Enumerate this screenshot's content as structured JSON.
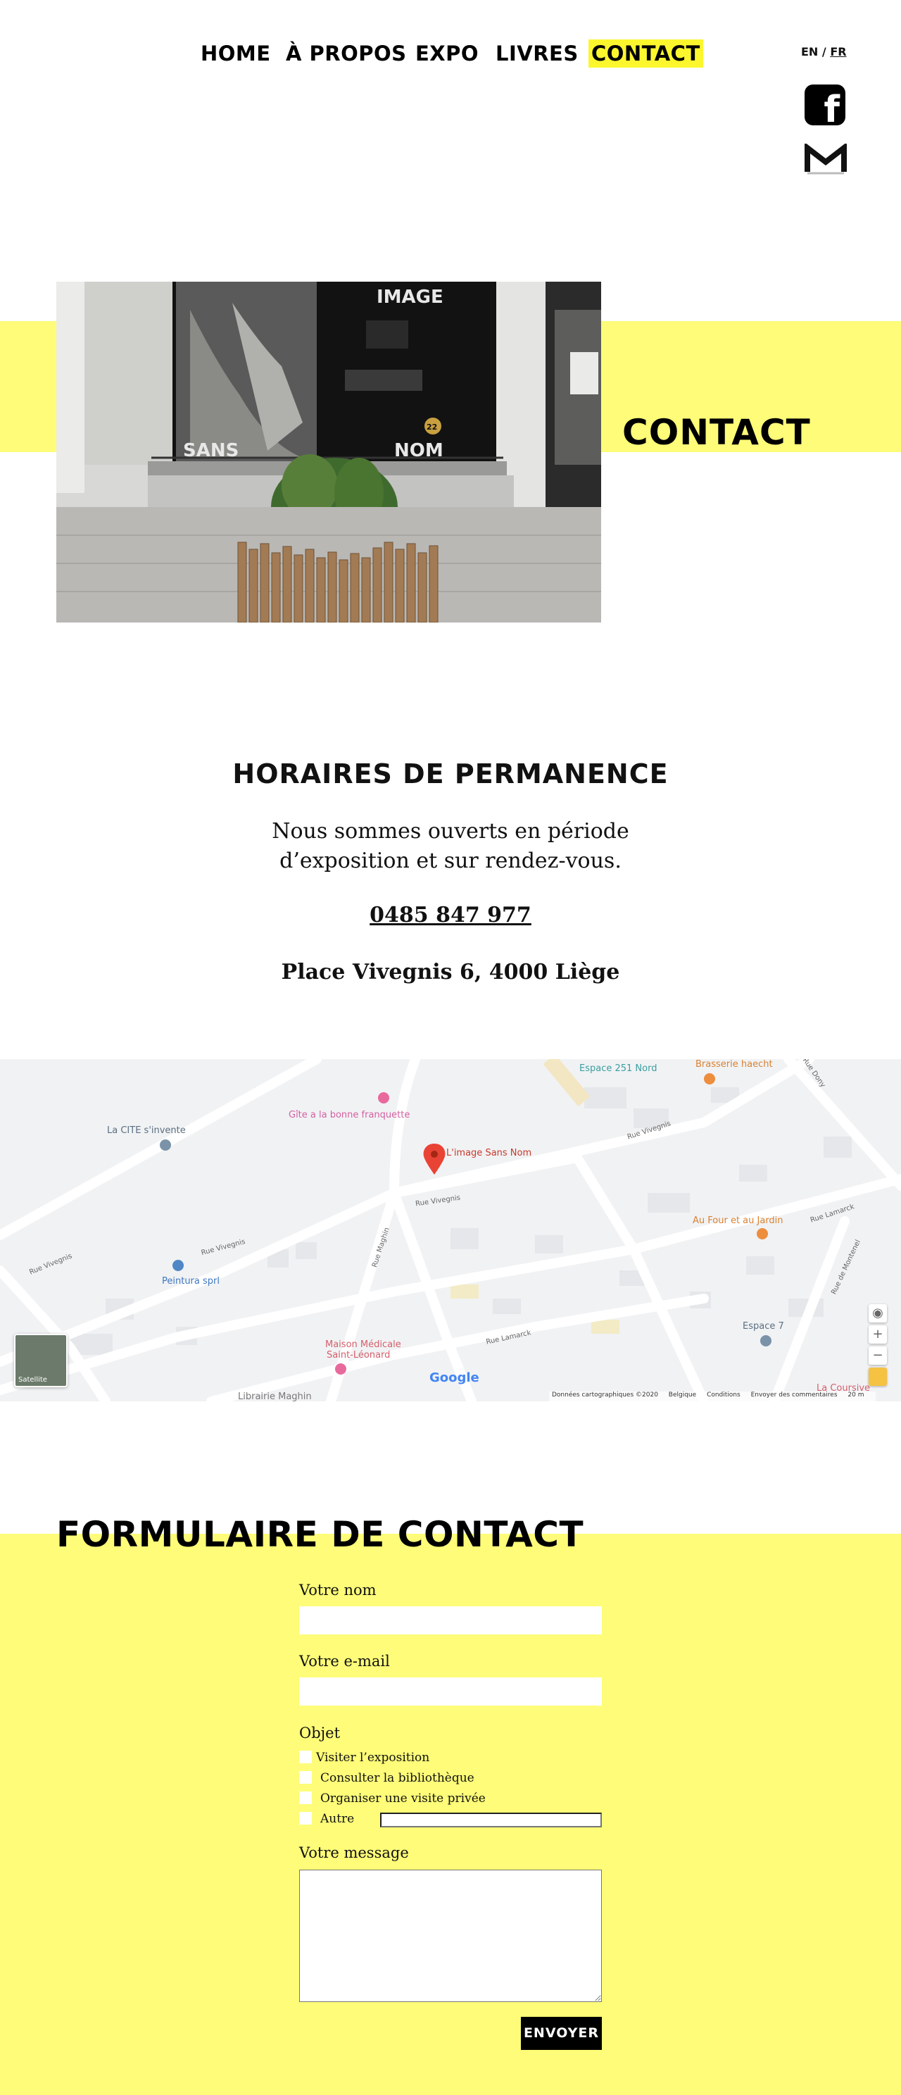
{
  "nav": {
    "items": [
      {
        "label": "HOME"
      },
      {
        "label": "À PROPOS"
      },
      {
        "label": "EXPO"
      },
      {
        "label": "LIVRES"
      },
      {
        "label": "CONTACT",
        "active": true
      }
    ],
    "lang_en": "EN",
    "lang_sep": " / ",
    "lang_fr": "FR",
    "facebook_glyph": "f"
  },
  "hero": {
    "title": "CONTACT",
    "photo_signs": [
      "IMAGE",
      "SANS",
      "NOM",
      "22"
    ]
  },
  "hours": {
    "title": "HORAIRES DE PERMANENCE",
    "text_line1": "Nous sommes ouverts en période",
    "text_line2": "d’exposition et sur rendez-vous.",
    "phone": "0485 847 977",
    "address": "Place Vivegnis 6, 4000 Liège"
  },
  "map": {
    "places": [
      {
        "name": "Espace 251 Nord"
      },
      {
        "name": "Brasserie haecht"
      },
      {
        "name": "Gîte a la bonne franquette"
      },
      {
        "name": "La CITE s'invente"
      },
      {
        "name": "L'image Sans Nom"
      },
      {
        "name": "Au Four et au Jardin"
      },
      {
        "name": "Peintura sprl"
      },
      {
        "name": "Espace 7"
      },
      {
        "name": "Maison Médicale"
      },
      {
        "name": "Saint-Léonard"
      },
      {
        "name": "Librairie Maghin"
      },
      {
        "name": "La Coursive"
      }
    ],
    "streets": [
      "Rue Vivegnis",
      "Rue Vivegnis",
      "Rue Vivegnis",
      "Rue Maghin",
      "Rue Lamarck",
      "Rue Lamarck",
      "Rue Dony",
      "Rue de Montenel",
      "Rue Vivegnis"
    ],
    "satellite_label": "Satellite",
    "google_label": "Google",
    "attribution": [
      "Données cartographiques ©2020",
      "Belgique",
      "Conditions",
      "Envoyer des commentaires",
      "20 m"
    ],
    "zoom_in": "+",
    "zoom_out": "−"
  },
  "form": {
    "title": "FORMULAIRE DE CONTACT",
    "name_label": "Votre nom",
    "email_label": "Votre e-mail",
    "subject_label": "Objet",
    "options": [
      "Visiter l’exposition",
      "Consulter la bibliothèque",
      "Organiser une visite privée",
      "Autre"
    ],
    "message_label": "Votre message",
    "submit": "ENVOYER"
  },
  "colors": {
    "accent_yellow": "#fefc78",
    "nav_highlight": "#fcf62e",
    "black": "#000000"
  }
}
